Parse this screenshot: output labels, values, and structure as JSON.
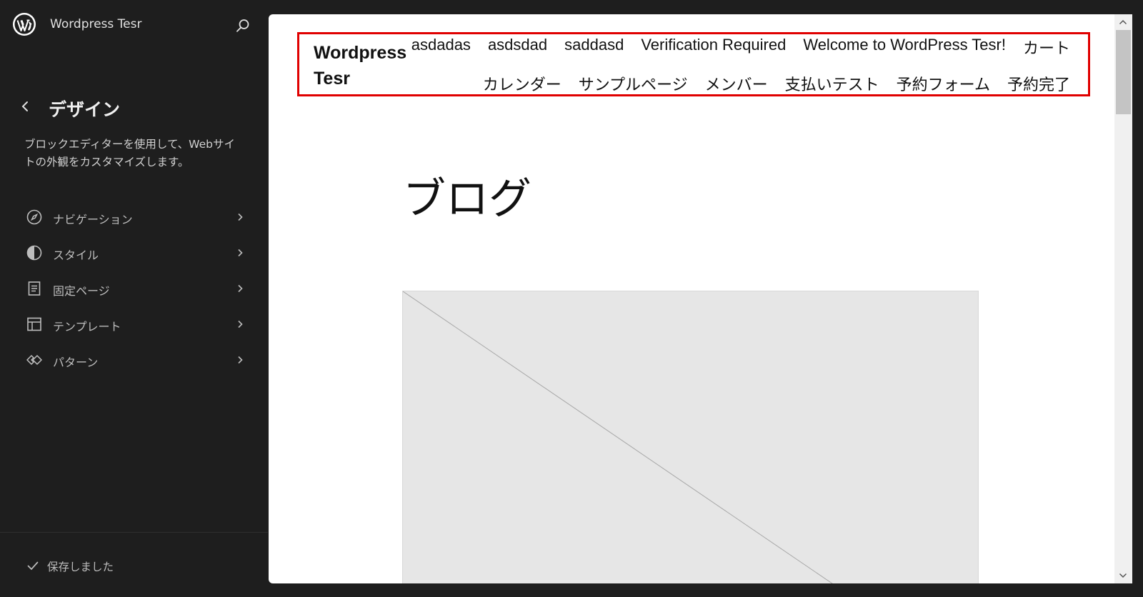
{
  "sidebar": {
    "site_name": "Wordpress Tesr",
    "panel_title": "デザイン",
    "panel_description": "ブロックエディターを使用して、Webサイトの外観をカスタマイズします。",
    "items": [
      {
        "label": "ナビゲーション",
        "icon": "navigation-compass-icon"
      },
      {
        "label": "スタイル",
        "icon": "styles-half-circle-icon"
      },
      {
        "label": "固定ページ",
        "icon": "page-icon"
      },
      {
        "label": "テンプレート",
        "icon": "template-layout-icon"
      },
      {
        "label": "パターン",
        "icon": "patterns-diamond-icon"
      }
    ],
    "saved_status": "保存しました"
  },
  "preview": {
    "site_title": "Wordpress Tesr",
    "nav_row1": [
      "asdadas",
      "asdsdad",
      "saddasd",
      "Verification Required",
      "Welcome to WordPress Tesr!",
      "カート"
    ],
    "nav_row2": [
      "カレンダー",
      "サンプルページ",
      "メンバー",
      "支払いテスト",
      "予約フォーム",
      "予約完了"
    ],
    "page_heading": "ブログ"
  },
  "colors": {
    "sidebar_bg": "#1e1e1e",
    "selection_outline": "#e00000",
    "preview_bg": "#ffffff",
    "placeholder_bg": "#e6e6e6"
  }
}
